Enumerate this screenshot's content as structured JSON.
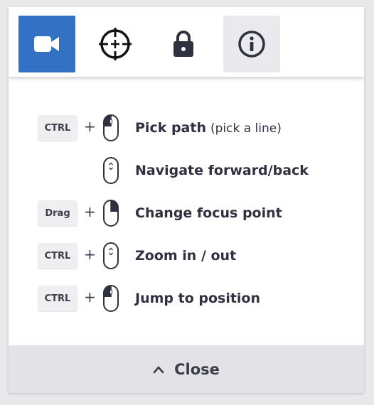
{
  "toolbar": {
    "tools": [
      {
        "icon": "video-camera-icon",
        "active": true
      },
      {
        "icon": "crosshair-icon",
        "active": false
      },
      {
        "icon": "lock-icon",
        "active": false
      },
      {
        "icon": "info-icon",
        "active": false
      }
    ],
    "accent_color": "#3271c4"
  },
  "shortcuts": [
    {
      "key": "CTRL",
      "plus": "+",
      "mouse": "left-click",
      "action": "Pick path",
      "note": "(pick a line)"
    },
    {
      "key": "",
      "plus": "",
      "mouse": "scroll-wheel",
      "action": "Navigate forward/back",
      "note": ""
    },
    {
      "key": "Drag",
      "plus": "+",
      "mouse": "right-click",
      "action": "Change focus point",
      "note": ""
    },
    {
      "key": "CTRL",
      "plus": "+",
      "mouse": "scroll-wheel",
      "action": "Zoom in / out",
      "note": ""
    },
    {
      "key": "CTRL",
      "plus": "+",
      "mouse": "left-click",
      "action": "Jump to position",
      "note": ""
    }
  ],
  "close": {
    "label": "Close"
  }
}
